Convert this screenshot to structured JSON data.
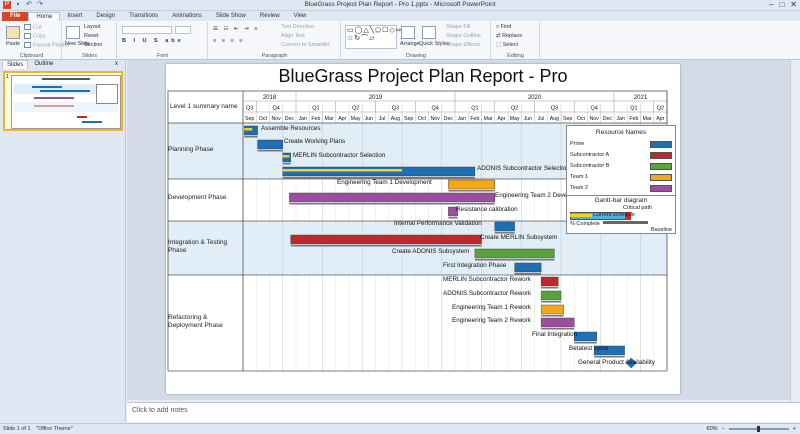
{
  "window": {
    "title": "BlueGrass Project Plan Report - Pro 1.pptx  -  Microsoft PowerPoint",
    "controls": [
      "–",
      "□",
      "✕"
    ]
  },
  "tabs": [
    "File",
    "Home",
    "Insert",
    "Design",
    "Transitions",
    "Animations",
    "Slide Show",
    "Review",
    "View"
  ],
  "ribbon": {
    "clipboard": {
      "label": "Clipboard",
      "paste": "Paste",
      "cut": "Cut",
      "copy": "Copy",
      "format_painter": "Format Painter"
    },
    "slides": {
      "label": "Slides",
      "new_slide": "New Slide",
      "layout": "Layout",
      "reset": "Reset",
      "section": "Section"
    },
    "font": {
      "label": "Font"
    },
    "paragraph": {
      "label": "Paragraph",
      "text_direction": "Text Direction",
      "align_text": "Align Text",
      "convert": "Convert to SmartArt"
    },
    "drawing": {
      "label": "Drawing",
      "arrange": "Arrange",
      "quick_styles": "Quick Styles",
      "fill": "Shape Fill",
      "outline": "Shape Outline",
      "effects": "Shape Effects"
    },
    "editing": {
      "label": "Editing",
      "find": "Find",
      "replace": "Replace",
      "select": "Select"
    }
  },
  "left_panel": {
    "tab_slides": "Slides",
    "tab_outline": "Outline",
    "close": "x",
    "slide_number": "1"
  },
  "notes_placeholder": "Click to add notes",
  "status": {
    "slide": "Slide 1 of 1",
    "theme": "\"Office Theme\"",
    "zoom": "60%"
  },
  "slide": {
    "title": "BlueGrass Project Plan Report - Pro",
    "level_header": "Level 1 summary name",
    "years": [
      "2018",
      "2019",
      "2020",
      "2021"
    ],
    "quarters": [
      "Q3",
      "Q4",
      "Q1",
      "Q2",
      "Q3",
      "Q4",
      "Q1",
      "Q2",
      "Q3",
      "Q4",
      "Q1",
      "Q2"
    ],
    "months": [
      "Sep",
      "Oct",
      "Nov",
      "Dec",
      "Jan",
      "Feb",
      "Mar",
      "Apr",
      "May",
      "Jun",
      "Jul",
      "Aug",
      "Sep",
      "Oct",
      "Nov",
      "Dec",
      "Jan",
      "Feb",
      "Mar",
      "Apr",
      "May",
      "Jun",
      "Jul",
      "Aug",
      "Sep",
      "Oct",
      "Nov",
      "Dec",
      "Jan",
      "Feb",
      "Mar",
      "Apr"
    ],
    "phases": [
      {
        "name": "Planning Phase"
      },
      {
        "name": "Development Phase"
      },
      {
        "name": "Integration & Testing Phase"
      },
      {
        "name": "Refactoring & Deployment Phase"
      }
    ],
    "tasks": [
      {
        "label": "Assemble Resources"
      },
      {
        "label": "Create Working Plans"
      },
      {
        "label": "MERLIN Subcontractor Selection"
      },
      {
        "label": "ADONIS Subcontractor Selection"
      },
      {
        "label": "Engineering Team 1 Development"
      },
      {
        "label": "Engineering Team 2 Development"
      },
      {
        "label": "Resistance calibration"
      },
      {
        "label": "Internal Performance Validation"
      },
      {
        "label": "Create MERLIN Subsystem"
      },
      {
        "label": "Create ADONIS Subsystem"
      },
      {
        "label": "First Integration Phase"
      },
      {
        "label": "MERLIN Subcontractor Rework"
      },
      {
        "label": "ADONIS Subcontractor Rework"
      },
      {
        "label": "Engineering Team 1 Rework"
      },
      {
        "label": "Engineering Team 2 Rework"
      },
      {
        "label": "Final Integration"
      },
      {
        "label": "Betatest cycle"
      },
      {
        "label": "General Product Availability"
      }
    ],
    "legend": {
      "title": "Resource Names",
      "items": [
        {
          "name": "Prime",
          "color": "#1f6fb5"
        },
        {
          "name": "Subcontractor A",
          "color": "#c0282d"
        },
        {
          "name": "Subcontractor B",
          "color": "#5aa33a"
        },
        {
          "name": "Team 1",
          "color": "#f3a81c"
        },
        {
          "name": "Team 2",
          "color": "#9b4f9e"
        }
      ],
      "diagram_title": "Gantt-bar diagram",
      "critical_path": "Critical path",
      "current_schedule": "Current schedule",
      "percent_complete": "% Complete",
      "baseline": "Baseline"
    }
  }
}
